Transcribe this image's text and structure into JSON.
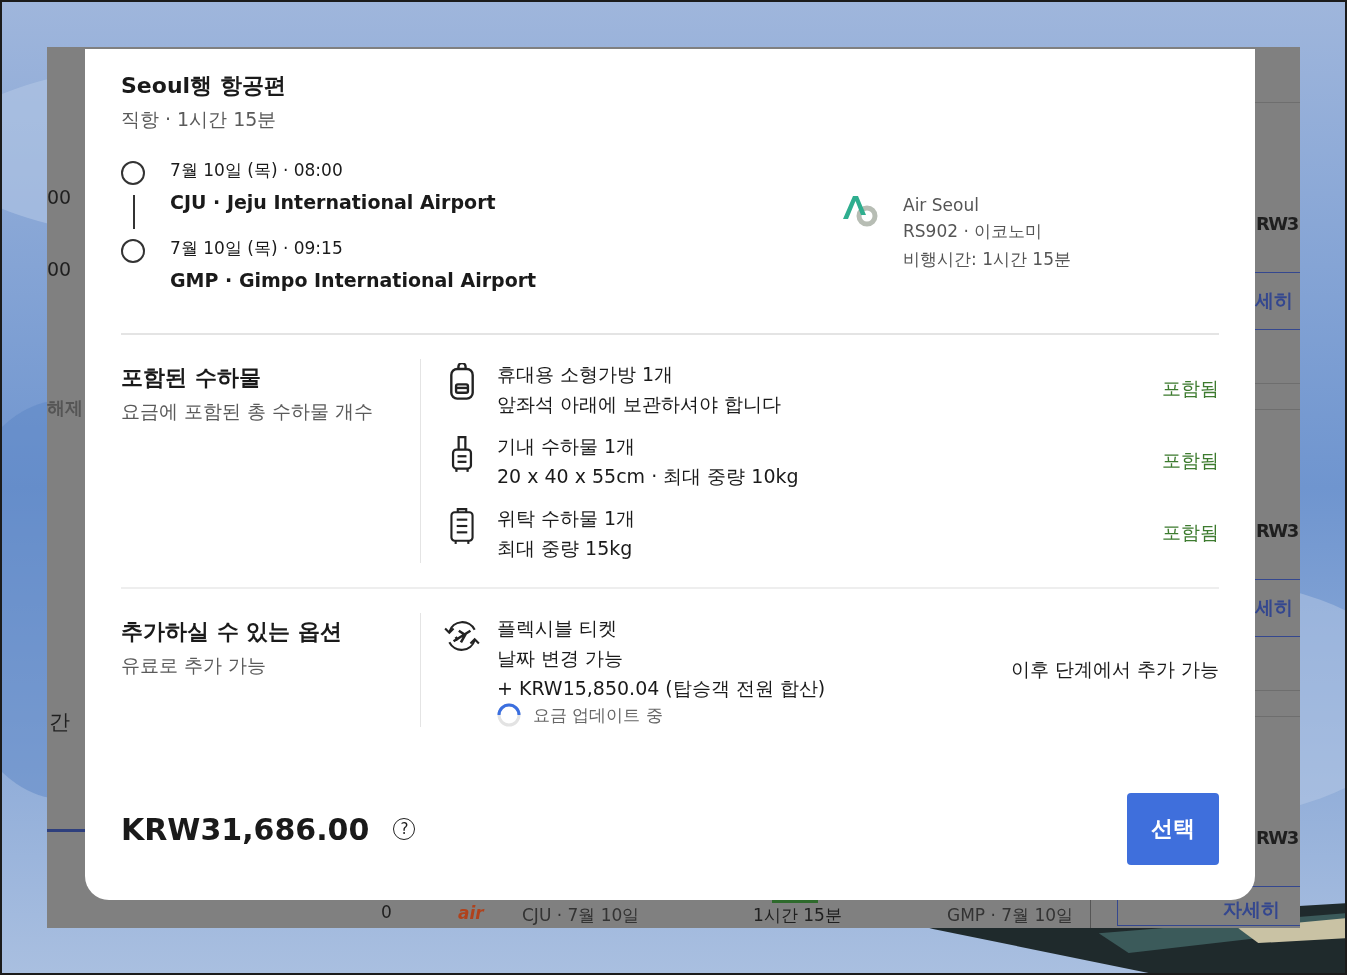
{
  "background_page": {
    "left_texts": [
      {
        "kind": "price",
        "text": "00"
      },
      {
        "kind": "price",
        "text": "00"
      },
      {
        "kind": "filter",
        "text": "해제"
      },
      {
        "kind": "heading",
        "text": "간"
      }
    ],
    "right_cards": [
      {
        "price": "RW3",
        "link": "세히"
      },
      {
        "price": "RW3",
        "link": "세히"
      },
      {
        "price": "RW3",
        "link": "자세히"
      }
    ],
    "bottom_row": {
      "count": "0",
      "airline_logo": "air",
      "departure": "CJU · 7월 10일",
      "duration": "1시간 15분",
      "arrival": "GMP · 7월 10일"
    }
  },
  "dialog": {
    "title": "Seoul행 항공편",
    "subtitle": "직항 · 1시간 15분",
    "stops": [
      {
        "time": "7월 10일 (목) · 08:00",
        "airport": "CJU · Jeju International Airport"
      },
      {
        "time": "7월 10일 (목) · 09:15",
        "airport": "GMP · Gimpo International Airport"
      }
    ],
    "flight_info": [
      "Air Seoul",
      "RS902 · 이코노미",
      "비행시간: 1시간 15분"
    ],
    "baggage": {
      "title": "포함된 수하물",
      "subtitle": "요금에 포함된 총 수하물 개수",
      "items": [
        {
          "kind": "personal",
          "name": "휴대용 소형가방 1개",
          "detail": "앞좌석 아래에 보관하셔야 합니다",
          "status": "포함됨"
        },
        {
          "kind": "carry_on",
          "name": "기내 수하물 1개",
          "detail": "20 x 40 x 55cm · 최대 중량 10kg",
          "status": "포함됨"
        },
        {
          "kind": "checked",
          "name": "위탁 수하물 1개",
          "detail": "최대 중량 15kg",
          "status": "포함됨"
        }
      ]
    },
    "options": {
      "title": "추가하실 수 있는 옵션",
      "subtitle": "유료로 추가 가능",
      "items": [
        {
          "kind": "flexible",
          "name": "플렉시블 티켓",
          "detail": "날짜 변경 가능",
          "price": "+ KRW15,850.04 (탑승객 전원 합산)",
          "updating": true,
          "updating_text": "요금 업데이트 중",
          "status": "이후 단계에서 추가 가능"
        }
      ]
    },
    "total_price": "KRW31,686.00",
    "help_glyph": "?",
    "select_button": "선택"
  }
}
